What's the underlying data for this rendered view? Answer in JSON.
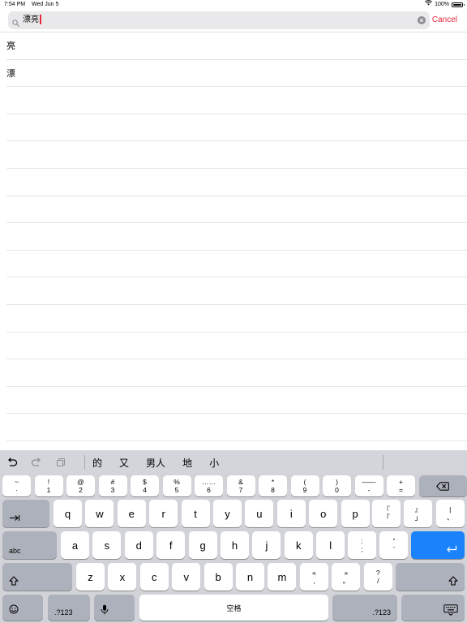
{
  "status_bar": {
    "time": "7:54 PM",
    "date": "Wed Jun 5",
    "battery": "100%",
    "battery_level": 1.0
  },
  "search": {
    "query": "漂亮",
    "cancel_label": "Cancel"
  },
  "results": [
    "亮",
    "漂",
    "",
    "",
    "",
    "",
    "",
    "",
    "",
    "",
    "",
    "",
    "",
    "",
    ""
  ],
  "candidates": [
    "的",
    "又",
    "男人",
    "地",
    "小"
  ],
  "keyboard": {
    "number_row": [
      {
        "top": "~",
        "bottom": "·"
      },
      {
        "top": "!",
        "bottom": "1"
      },
      {
        "top": "@",
        "bottom": "2"
      },
      {
        "top": "#",
        "bottom": "3"
      },
      {
        "top": "$",
        "bottom": "4"
      },
      {
        "top": "%",
        "bottom": "5"
      },
      {
        "top": "……",
        "bottom": "6"
      },
      {
        "top": "&",
        "bottom": "7"
      },
      {
        "top": "*",
        "bottom": "8"
      },
      {
        "top": "(",
        "bottom": "9"
      },
      {
        "top": ")",
        "bottom": "0"
      },
      {
        "top": "——",
        "bottom": "-"
      },
      {
        "top": "+",
        "bottom": "="
      }
    ],
    "row1": [
      "q",
      "w",
      "e",
      "r",
      "t",
      "y",
      "u",
      "i",
      "o",
      "p"
    ],
    "row1_punct": [
      {
        "top": "『",
        "bottom": "「"
      },
      {
        "top": "』",
        "bottom": "」"
      },
      {
        "top": "|",
        "bottom": "、"
      }
    ],
    "row2": [
      "a",
      "s",
      "d",
      "f",
      "g",
      "h",
      "j",
      "k",
      "l"
    ],
    "row2_punct": [
      {
        "top": ":",
        "bottom": ";"
      },
      {
        "top": "”",
        "bottom": "’"
      }
    ],
    "row3": [
      "z",
      "x",
      "c",
      "v",
      "b",
      "n",
      "m"
    ],
    "row3_punct": [
      {
        "top": "«",
        "bottom": ","
      },
      {
        "top": "»",
        "bottom": "。"
      },
      {
        "top": "?",
        "bottom": "/"
      }
    ],
    "abc_label": "abc",
    "numbers_label": ".?123",
    "space_label": "空格"
  }
}
